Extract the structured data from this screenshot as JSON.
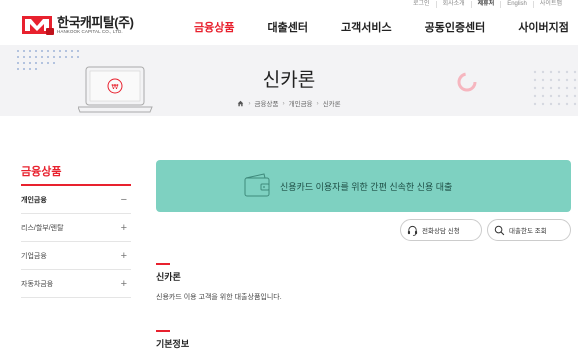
{
  "util_links": [
    "로그인",
    "회사소개",
    "제휴처",
    "English",
    "사이트맵"
  ],
  "logo": {
    "korean": "한국캐피탈(주)",
    "english": "HANKOOK CAPITAL CO., LTD."
  },
  "gnb": [
    "금융상품",
    "대출센터",
    "고객서비스",
    "공동인증센터",
    "사이버지점"
  ],
  "banner": {
    "title": "신카론",
    "breadcrumb": [
      "금융상품",
      "개인금융",
      "신카론"
    ]
  },
  "sidebar": {
    "title": "금융상품",
    "items": [
      {
        "label": "개인금융",
        "toggle": "−"
      },
      {
        "label": "리스/할부/렌탈",
        "toggle": "+"
      },
      {
        "label": "기업금융",
        "toggle": "+"
      },
      {
        "label": "자동차금융",
        "toggle": "+"
      }
    ]
  },
  "hero": {
    "text": "신용카드 이용자를 위한 간편 신속한 신용 대출"
  },
  "buttons": {
    "consult": "전화상담 신청",
    "limit": "대출한도 조회"
  },
  "section1": {
    "title": "신카론",
    "desc": "신용카드 이용 고객을 위한 대출상품입니다."
  },
  "section2": {
    "title": "기본정보"
  },
  "colors": {
    "accent": "#e8212e",
    "hero": "#7ed1c1",
    "banner_bg": "#f3f3f5"
  }
}
